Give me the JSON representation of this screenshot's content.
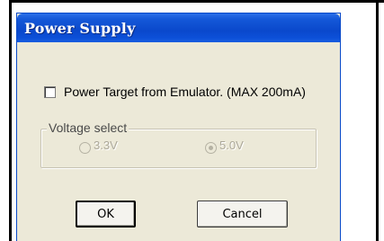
{
  "dialog": {
    "title": "Power Supply",
    "checkbox": {
      "label": "Power Target from Emulator. (MAX 200mA)",
      "checked": false
    },
    "voltage_group": {
      "legend": "Voltage select",
      "options": [
        {
          "label": "3.3V",
          "selected": false,
          "enabled": false
        },
        {
          "label": "5.0V",
          "selected": true,
          "enabled": false
        }
      ]
    },
    "buttons": {
      "ok": "OK",
      "cancel": "Cancel"
    }
  },
  "colors": {
    "titlebar": "#0a48cc",
    "dialog_bg": "#ece9d8",
    "disabled_text": "#aca899"
  }
}
